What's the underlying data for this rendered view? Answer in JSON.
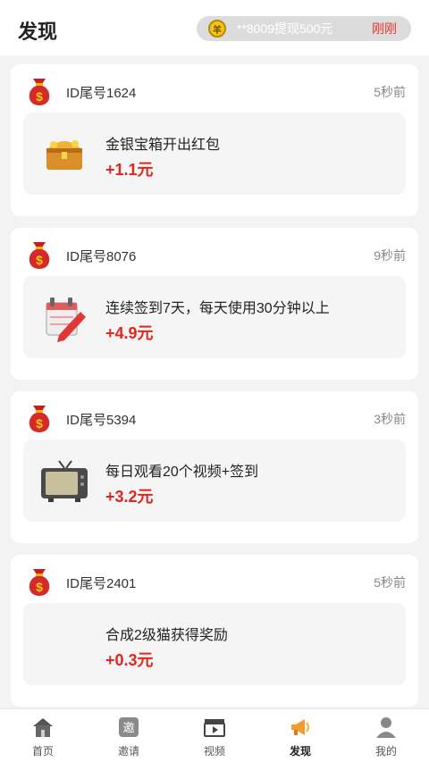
{
  "header": {
    "title": "发现",
    "ticker": {
      "coin_glyph": "羊",
      "text": "**8009提现500元",
      "time": "刚刚"
    }
  },
  "feed": [
    {
      "user": "ID尾号1624",
      "time": "5秒前",
      "task": "金银宝箱开出红包",
      "reward": "+1.1元",
      "icon": "treasure-chest-icon"
    },
    {
      "user": "ID尾号8076",
      "time": "9秒前",
      "task": "连续签到7天，每天使用30分钟以上",
      "reward": "+4.9元",
      "icon": "calendar-pencil-icon"
    },
    {
      "user": "ID尾号5394",
      "time": "3秒前",
      "task": "每日观看20个视频+签到",
      "reward": "+3.2元",
      "icon": "tv-icon"
    },
    {
      "user": "ID尾号2401",
      "time": "5秒前",
      "task": "合成2级猫获得奖励",
      "reward": "+0.3元",
      "icon": "cat-icon"
    }
  ],
  "tabbar": [
    {
      "label": "首页",
      "icon": "home-icon"
    },
    {
      "label": "邀请",
      "icon": "invite-icon",
      "icon_glyph": "邀"
    },
    {
      "label": "视频",
      "icon": "video-icon"
    },
    {
      "label": "发现",
      "icon": "megaphone-icon",
      "active": true
    },
    {
      "label": "我的",
      "icon": "profile-icon"
    }
  ],
  "colors": {
    "accent_red": "#e0261e",
    "ticker_bg": "#dcdcdc",
    "coin": "#f5c518"
  }
}
